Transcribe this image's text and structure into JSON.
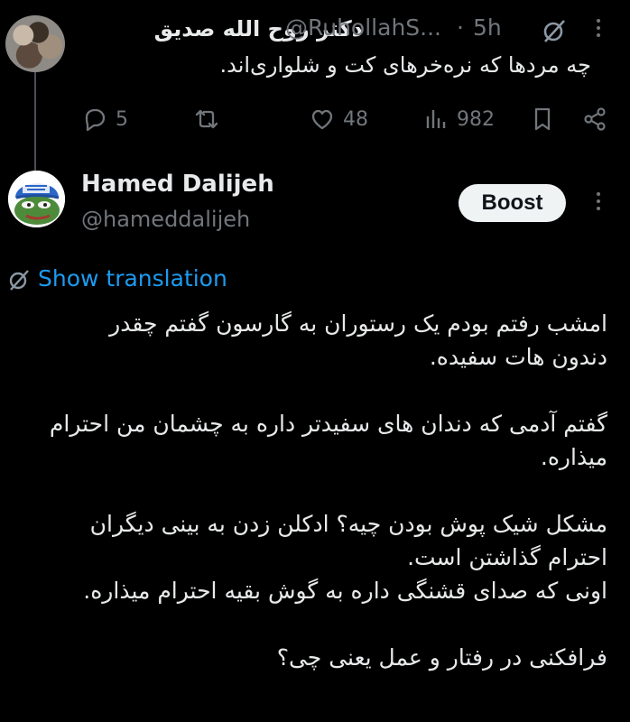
{
  "tweet1": {
    "author_name": "دکتر روح الله صدیق",
    "handle": "@RuhollahS...",
    "separator": "·",
    "time": "5h",
    "text": "چه مردها که نره‌خرهای کت و شلواری‌اند.",
    "actions": {
      "replies": "5",
      "retweets": "",
      "likes": "48",
      "views": "982"
    }
  },
  "tweet2": {
    "author_name": "Hamed Dalijeh",
    "handle": "@hameddalijeh",
    "boost_label": "Boost",
    "show_translation": "Show translation",
    "paragraphs": [
      [
        "امشب رفتم بودم یک رستوران به گارسون گفتم چقدر",
        "دندون هات سفیده."
      ],
      [
        "گفتم آدمی که دندان های سفیدتر داره به چشمان من احترام",
        "میذاره."
      ],
      [
        "مشکل شیک پوش بودن چیه؟ ادکلن زدن به بینی دیگران",
        "احترام گذاشتن است.",
        "اونی که صدای قشنگی داره به گوش بقیه احترام میذاره."
      ],
      [
        "فرافکنی در رفتار و عمل یعنی چی؟"
      ]
    ]
  },
  "colors": {
    "background": "#000000",
    "text": "#e7e9ea",
    "muted": "#71767b",
    "link": "#1d9bf0"
  },
  "icons": [
    "reply-icon",
    "retweet-icon",
    "like-icon",
    "views-icon",
    "bookmark-icon",
    "share-icon",
    "more-icon",
    "grok-icon"
  ]
}
